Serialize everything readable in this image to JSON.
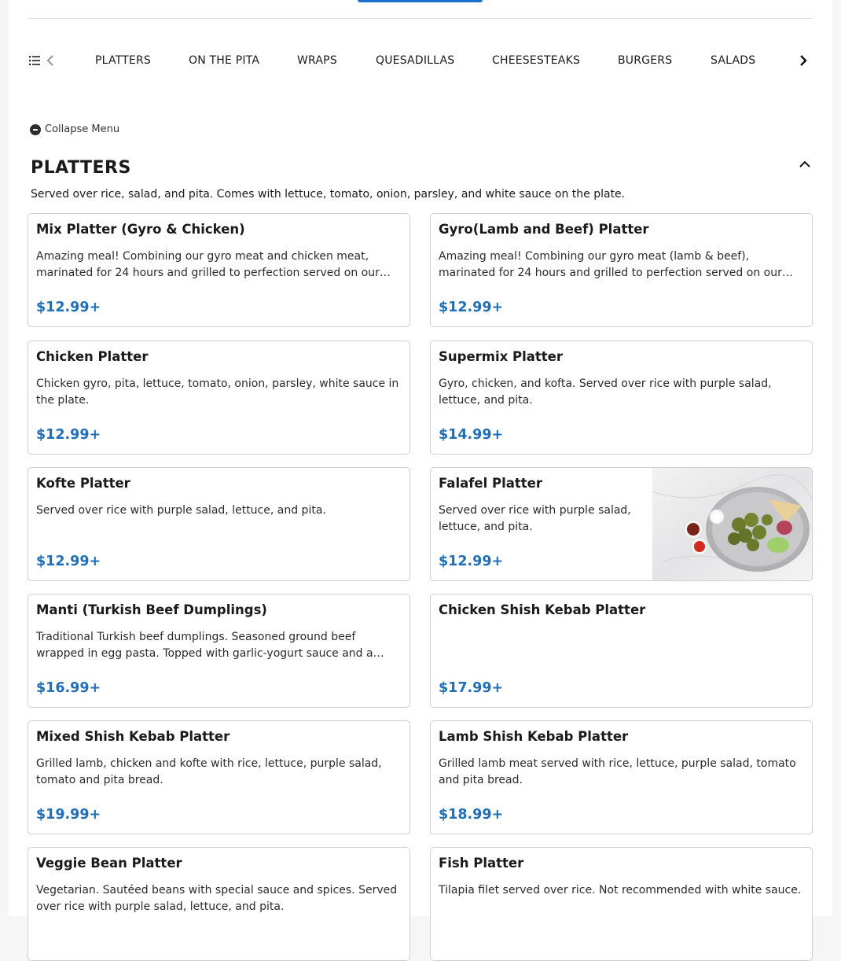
{
  "nav": {
    "categories": [
      {
        "label": "PLATTERS"
      },
      {
        "label": "ON THE PITA"
      },
      {
        "label": "WRAPS"
      },
      {
        "label": "QUESADILLAS"
      },
      {
        "label": "CHEESESTEAKS"
      },
      {
        "label": "BURGERS"
      },
      {
        "label": "SALADS"
      }
    ],
    "list_icon": "list-icon",
    "prev_icon": "chevron-left-icon",
    "next_icon": "chevron-right-icon"
  },
  "collapse": {
    "label": "Collapse Menu",
    "icon": "minus-circle-icon"
  },
  "section": {
    "title": "PLATTERS",
    "description": "Served over rice, salad, and pita. Comes with lettuce, tomato, onion, parsley, and white sauce on the plate.",
    "toggle_icon": "chevron-up-icon"
  },
  "items": [
    {
      "name": "Mix Platter (Gyro & Chicken)",
      "description": "Amazing meal! Combining our gyro meat and chicken meat, marinated for 24 hours and grilled to perfection served on our…",
      "price": "$12.99+"
    },
    {
      "name": "Gyro(Lamb and Beef) Platter",
      "description": "Amazing meal! Combining our gyro meat (lamb & beef), marinated for 24 hours and grilled to perfection served on our…",
      "price": "$12.99+"
    },
    {
      "name": "Chicken Platter",
      "description": "Chicken gyro, pita, lettuce, tomato, onion, parsley, white sauce in the plate.",
      "price": "$12.99+"
    },
    {
      "name": "Supermix Platter",
      "description": "Gyro, chicken, and kofta. Served over rice with purple salad, lettuce, and pita.",
      "price": "$14.99+"
    },
    {
      "name": "Kofte Platter",
      "description": "Served over rice with purple salad, lettuce, and pita.",
      "price": "$12.99+"
    },
    {
      "name": "Falafel Platter",
      "description": "Served over rice with purple salad, lettuce, and pita.",
      "price": "$12.99+"
    },
    {
      "name": "Manti (Turkish Beef Dumplings)",
      "description": "Traditional Turkish beef dumplings. Seasoned ground beef wrapped in egg pasta. Topped with garlic-yogurt sauce and a…",
      "price": "$16.99+"
    },
    {
      "name": "Chicken Shish Kebab Platter",
      "description": "",
      "price": "$17.99+"
    },
    {
      "name": "Mixed Shish Kebab Platter",
      "description": "Grilled lamb, chicken and kofte with rice, lettuce, purple salad, tomato and pita bread.",
      "price": "$19.99+"
    },
    {
      "name": "Lamb Shish Kebab Platter",
      "description": "Grilled lamb meat served with rice, lettuce, purple salad, tomato and pita bread.",
      "price": "$18.99+"
    },
    {
      "name": "Veggie Bean Platter",
      "description": "Vegetarian. Sautéed beans with special sauce and spices. Served over rice with purple salad, lettuce, and pita.",
      "price": ""
    },
    {
      "name": "Fish Platter",
      "description": "Tilapia filet served over rice. Not recommended with white sauce.",
      "price": ""
    }
  ],
  "colors": {
    "price": "#1f6eb7",
    "accent": "#1a6fc9"
  }
}
